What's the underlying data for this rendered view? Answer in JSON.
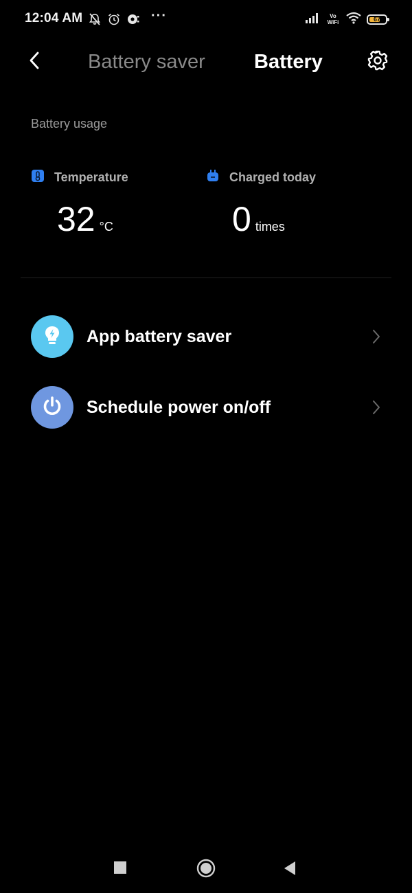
{
  "status_bar": {
    "time": "12:04 AM",
    "more_indicator": "···",
    "vowifi_top": "Vo",
    "vowifi_bottom": "WiFi",
    "battery_level": "67",
    "battery_percent": 67,
    "left_icons": [
      "bell-off-icon",
      "alarm-icon",
      "notification-app-icon"
    ],
    "right_icons": [
      "signal-icon",
      "vowifi-icon",
      "wifi-icon",
      "battery-icon"
    ]
  },
  "header": {
    "back_icon": "chevron-left-icon",
    "tab_battery_saver": "Battery saver",
    "tab_battery": "Battery",
    "settings_icon": "gear-icon"
  },
  "battery_usage": {
    "section_label": "Battery usage",
    "temperature": {
      "label": "Temperature",
      "value": "32",
      "unit": "°C",
      "icon": "thermometer-icon"
    },
    "charged_today": {
      "label": "Charged today",
      "value": "0",
      "unit": "times",
      "icon": "plug-icon"
    }
  },
  "menu": {
    "items": [
      {
        "label": "App battery saver",
        "icon": "lightbulb-bolt-icon",
        "color": "#5ac8f0"
      },
      {
        "label": "Schedule power on/off",
        "icon": "power-icon",
        "color": "#6f97e0"
      }
    ]
  },
  "colors": {
    "background": "#000000",
    "accent_blue": "#2f7ff0",
    "battery_fill": "#f3b43a",
    "muted_text": "#8a8a8a"
  },
  "nav_bar": {
    "icons": [
      "recents-square-icon",
      "home-circle-icon",
      "back-triangle-icon"
    ]
  }
}
